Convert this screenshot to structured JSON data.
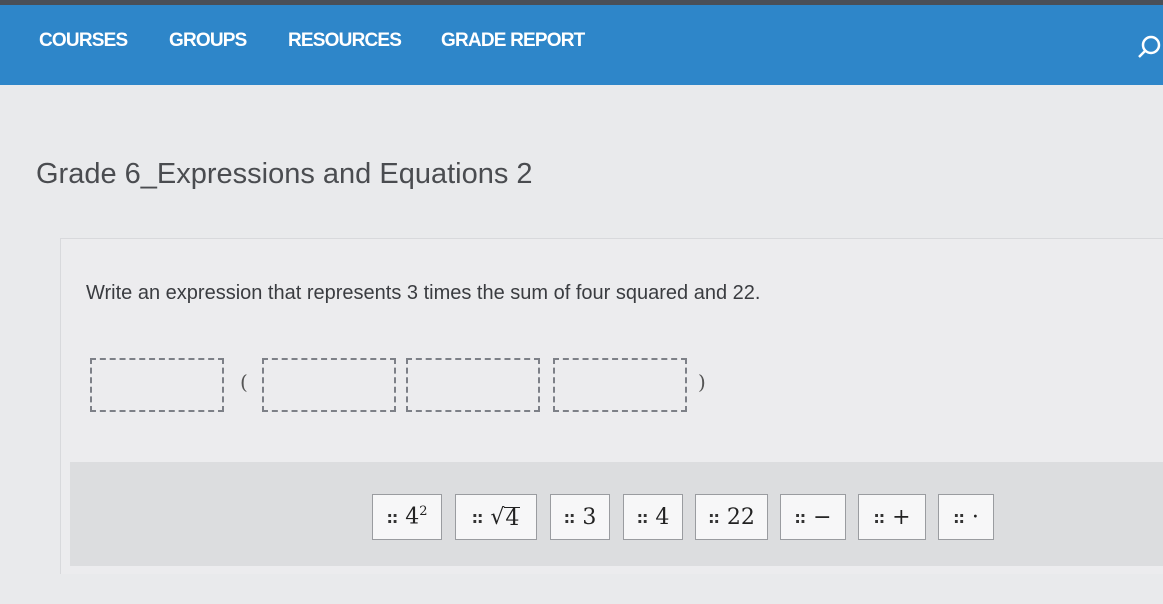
{
  "nav": {
    "items": [
      "COURSES",
      "GROUPS",
      "RESOURCES",
      "GRADE REPORT"
    ]
  },
  "page": {
    "title": "Grade 6_Expressions and Equations 2"
  },
  "question": {
    "prompt": "Write an expression that represents 3 times the sum of four squared and 22.",
    "open_paren": "(",
    "close_paren": ")"
  },
  "tiles": {
    "grip": "::",
    "four_squared": {
      "base": "4",
      "exp": "2"
    },
    "sqrt_four": {
      "symbol": "√",
      "arg": "4"
    },
    "three": "3",
    "four": "4",
    "twenty_two": "22",
    "minus": "−",
    "plus": "+",
    "dot": "·"
  },
  "colors": {
    "navbar": "#2e86c9",
    "background": "#e9eaec",
    "tray": "#dcdddf"
  }
}
